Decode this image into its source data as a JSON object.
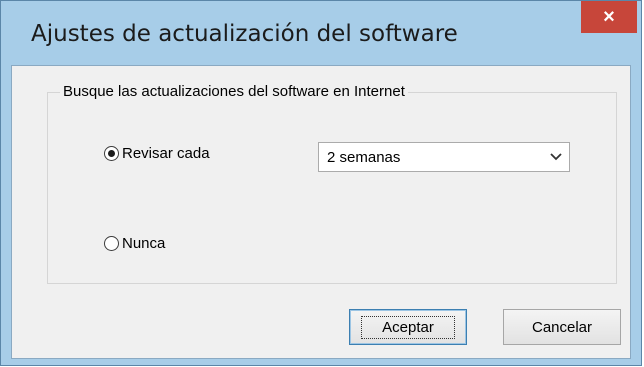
{
  "window": {
    "title": "Ajustes de actualización del software",
    "close_glyph": "×"
  },
  "group": {
    "legend": "Busque las actualizaciones del software en Internet"
  },
  "options": {
    "check_every": {
      "label": "Revisar cada",
      "selected": true
    },
    "never": {
      "label": "Nunca",
      "selected": false
    }
  },
  "interval": {
    "value": "2 semanas",
    "icon": "chevron-down-icon"
  },
  "buttons": {
    "ok": "Aceptar",
    "cancel": "Cancelar"
  },
  "colors": {
    "titlebar": "#a7cde8",
    "close": "#c7463a",
    "client": "#f0f0f0"
  }
}
